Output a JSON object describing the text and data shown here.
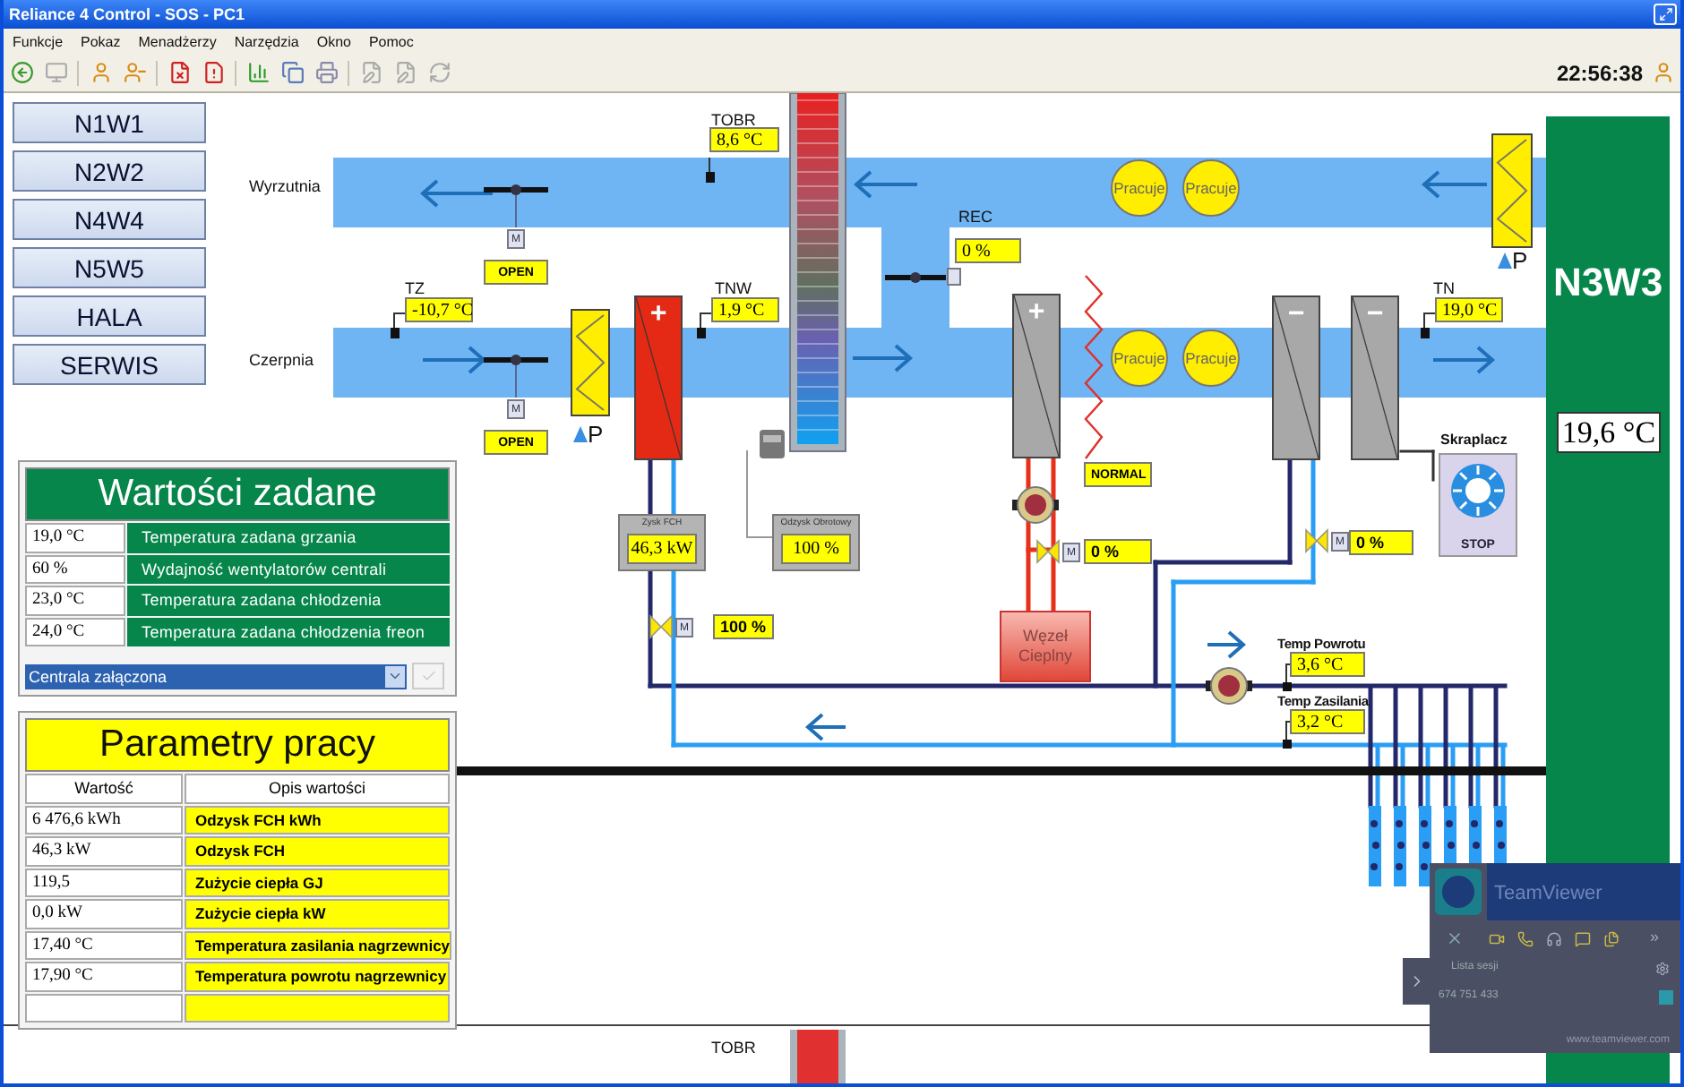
{
  "window": {
    "title": "Reliance 4 Control - SOS - PC1"
  },
  "menu": [
    "Funkcje",
    "Pokaz",
    "Menadżerzy",
    "Narzędzia",
    "Okno",
    "Pomoc"
  ],
  "toolbar": {
    "clock": "22:56:38"
  },
  "nav": [
    {
      "label": "N1W1"
    },
    {
      "label": "N2W2"
    },
    {
      "label": "N4W4"
    },
    {
      "label": "N5W5"
    },
    {
      "label": "HALA"
    },
    {
      "label": "SERWIS"
    }
  ],
  "setpoints": {
    "title": "Wartości zadane",
    "rows": [
      {
        "value": "19,0 °C",
        "label": "Temperatura zadana grzania"
      },
      {
        "value": "60 %",
        "label": "Wydajność wentylatorów centrali"
      },
      {
        "value": "23,0 °C",
        "label": "Temperatura zadana chłodzenia"
      },
      {
        "value": "24,0 °C",
        "label": "Temperatura zadana chłodzenia freon"
      }
    ],
    "mode": {
      "value": "Centrala załączona"
    }
  },
  "parameters": {
    "title": "Parametry pracy",
    "columns": [
      "Wartość",
      "Opis wartości"
    ],
    "rows": [
      {
        "value": "6 476,6 kWh",
        "label": "Odzysk FCH kWh"
      },
      {
        "value": "46,3 kW",
        "label": "Odzysk FCH"
      },
      {
        "value": "119,5",
        "label": "Zużycie ciepła GJ"
      },
      {
        "value": "0,0 kW",
        "label": "Zużycie ciepła  kW"
      },
      {
        "value": "17,40 °C",
        "label": "Temperatura zasilania nagrzewnicy"
      },
      {
        "value": "17,90 °C",
        "label": "Temperatura powrotu nagrzewnicy"
      }
    ]
  },
  "diagram": {
    "ducts": [
      {
        "label": "Wyrzutnia"
      },
      {
        "label": "Czerpnia"
      }
    ],
    "sensors": [
      {
        "label": "TOBR",
        "value": "8,6 °C"
      },
      {
        "label": "TZ",
        "value": "-10,7 °C"
      },
      {
        "label": "TNW",
        "value": "1,9 °C"
      },
      {
        "label": "REC",
        "value": "0 %"
      },
      {
        "label": "TN",
        "value": "19,0 °C"
      }
    ],
    "dampers": [
      {
        "state": "OPEN",
        "actuator": "M"
      },
      {
        "state": "OPEN",
        "actuator": "M"
      }
    ],
    "filters": [
      {
        "dp_label": "P"
      },
      {
        "dp_label": "P"
      }
    ],
    "fans": [
      {
        "status": "Pracuje"
      },
      {
        "status": "Pracuje"
      },
      {
        "status": "Pracuje"
      },
      {
        "status": "Pracuje"
      }
    ],
    "coils": [
      {
        "kind": "water-heater",
        "sign": "+"
      },
      {
        "kind": "heater",
        "sign": "+"
      },
      {
        "kind": "cooler",
        "sign": "−"
      },
      {
        "kind": "cooler",
        "sign": "−"
      }
    ],
    "electric_heater": {
      "status": "NORMAL"
    },
    "meters": [
      {
        "label": "Zysk FCH",
        "value": "46,3 kW"
      },
      {
        "label": "Odzysk Obrotowy",
        "value": "100 %"
      }
    ],
    "valves": [
      {
        "value": "100 %",
        "actuator": "M"
      },
      {
        "value": "0 %",
        "actuator": "M"
      },
      {
        "value": "0 %",
        "actuator": "M"
      }
    ],
    "heat_node": {
      "label": "Węzeł Cieplny"
    },
    "condenser": {
      "label": "Skraplacz",
      "status": "STOP"
    },
    "loop_temps": [
      {
        "label": "Temp Powrotu",
        "value": "3,6 °C"
      },
      {
        "label": "Temp Zasilania",
        "value": "3,2 °C"
      }
    ],
    "zone": {
      "label": "N3W3",
      "value": "19,6 °C"
    },
    "bottom_sensor": {
      "label": "TOBR"
    }
  },
  "teamviewer": {
    "title": "TeamViewer",
    "more": "»",
    "section": "Lista sesji",
    "id": "674 751 433",
    "link": "www.teamviewer.com"
  }
}
